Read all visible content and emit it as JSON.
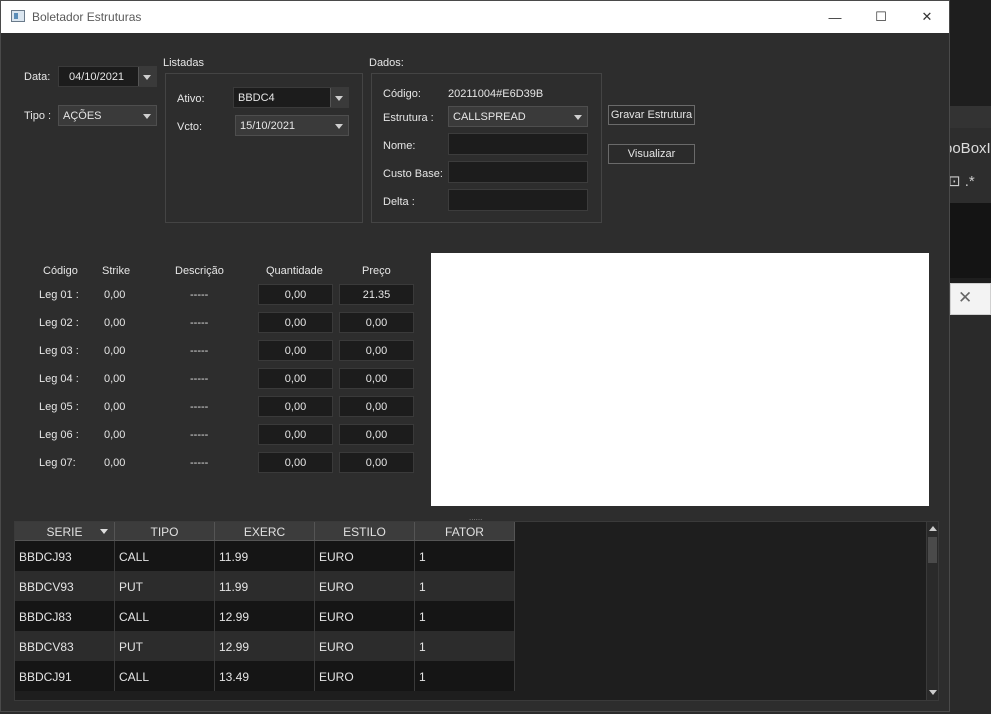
{
  "window": {
    "title": "Boletador Estruturas",
    "minimize": "—",
    "maximize": "☐",
    "close": "✕"
  },
  "background": {
    "partial_text": "ooBoxI",
    "icons_text": "⊡ .*"
  },
  "left": {
    "data_label": "Data:",
    "data_value": "04/10/2021",
    "tipo_label": "Tipo :",
    "tipo_value": "AÇÕES"
  },
  "listadas": {
    "title": "Listadas",
    "ativo_label": "Ativo:",
    "ativo_value": "BBDC4",
    "vcto_label": "Vcto:",
    "vcto_value": "15/10/2021"
  },
  "dados": {
    "title": "Dados:",
    "codigo_label": "Código:",
    "codigo_value": "20211004#E6D39B",
    "estrutura_label": "Estrutura :",
    "estrutura_value": "CALLSPREAD",
    "nome_label": "Nome:",
    "nome_value": "",
    "custo_label": "Custo Base:",
    "custo_value": "",
    "delta_label": "Delta :",
    "delta_value": ""
  },
  "buttons": {
    "gravar": "Gravar Estrutura",
    "visualizar": "Visualizar"
  },
  "legs": {
    "headers": {
      "codigo": "Código",
      "strike": "Strike",
      "descricao": "Descrição",
      "quantidade": "Quantidade",
      "preco": "Preço"
    },
    "rows": [
      {
        "label": "Leg 01 :",
        "strike": "0,00",
        "descricao": "-----",
        "quantidade": "0,00",
        "preco": "21.35"
      },
      {
        "label": "Leg 02 :",
        "strike": "0,00",
        "descricao": "-----",
        "quantidade": "0,00",
        "preco": "0,00"
      },
      {
        "label": "Leg 03 :",
        "strike": "0,00",
        "descricao": "-----",
        "quantidade": "0,00",
        "preco": "0,00"
      },
      {
        "label": "Leg 04 :",
        "strike": "0,00",
        "descricao": "-----",
        "quantidade": "0,00",
        "preco": "0,00"
      },
      {
        "label": "Leg 05 :",
        "strike": "0,00",
        "descricao": "-----",
        "quantidade": "0,00",
        "preco": "0,00"
      },
      {
        "label": "Leg 06 :",
        "strike": "0,00",
        "descricao": "-----",
        "quantidade": "0,00",
        "preco": "0,00"
      },
      {
        "label": "Leg 07:",
        "strike": "0,00",
        "descricao": "-----",
        "quantidade": "0,00",
        "preco": "0,00"
      }
    ]
  },
  "splitter": "......",
  "table": {
    "columns": [
      "SERIE",
      "TIPO",
      "EXERC",
      "ESTILO",
      "FATOR"
    ],
    "rows": [
      [
        "BBDCJ93",
        "CALL",
        "11.99",
        "EURO",
        "1"
      ],
      [
        "BBDCV93",
        "PUT",
        "11.99",
        "EURO",
        "1"
      ],
      [
        "BBDCJ83",
        "CALL",
        "12.99",
        "EURO",
        "1"
      ],
      [
        "BBDCV83",
        "PUT",
        "12.99",
        "EURO",
        "1"
      ],
      [
        "BBDCJ91",
        "CALL",
        "13.49",
        "EURO",
        "1"
      ]
    ]
  }
}
